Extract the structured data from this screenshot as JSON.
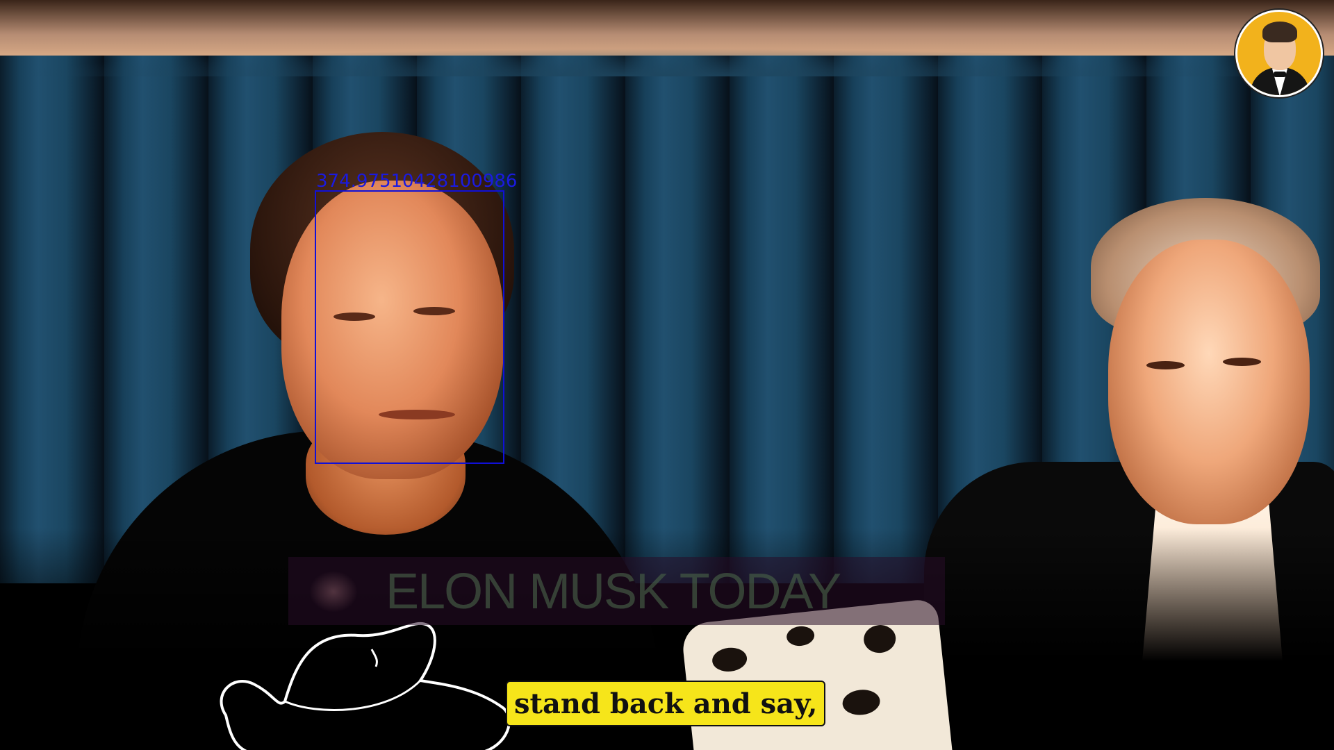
{
  "scene": {
    "description_colors": {
      "curtain": "#17405a",
      "caption_bg": "#f6e51a",
      "detection_box": "#1010d8",
      "avatar_bg": "#f2b21c"
    }
  },
  "detection": {
    "label": "374.97510428100986"
  },
  "watermark": {
    "text": "ELON MUSK TODAY"
  },
  "caption": {
    "text": "stand back and say,"
  },
  "avatar": {
    "icon": "channel-avatar-icon"
  }
}
